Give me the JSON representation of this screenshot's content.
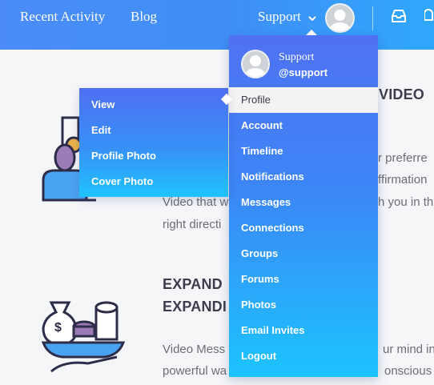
{
  "nav": {
    "links": [
      "Recent Activity",
      "Blog"
    ],
    "support_label": "Support",
    "caret_icon": "chevron-down-icon",
    "avatar_icon": "avatar-icon",
    "inbox_icon": "inbox-icon",
    "bell_icon": "bell-icon"
  },
  "content": {
    "section1": {
      "heading_fragment": "VIDEO",
      "lines": [
        "r preferre",
        "ffirmation",
        "Video that w",
        "h you in th",
        "right directi"
      ]
    },
    "section2": {
      "heading_line1": "EXPAND",
      "heading_line2": "EXPANDI",
      "lines": [
        "Video Mess",
        "ur mind in",
        "powerful wa",
        "onscious"
      ]
    }
  },
  "dropdown": {
    "user_name": "Support",
    "user_handle": "@support",
    "items": [
      {
        "label": "Profile",
        "active": true
      },
      {
        "label": "Account"
      },
      {
        "label": "Timeline"
      },
      {
        "label": "Notifications"
      },
      {
        "label": "Messages"
      },
      {
        "label": "Connections"
      },
      {
        "label": "Groups"
      },
      {
        "label": "Forums"
      },
      {
        "label": "Photos"
      },
      {
        "label": "Email Invites"
      },
      {
        "label": "Logout"
      }
    ]
  },
  "submenu": {
    "items": [
      "View",
      "Edit",
      "Profile Photo",
      "Cover Photo"
    ]
  },
  "colors": {
    "accent_start": "#4b8cf8",
    "accent_end": "#1cc4fd",
    "icon_stroke": "#2d2d4a",
    "icon_purple": "#9b7bb5",
    "icon_blue": "#4aa3f0"
  }
}
